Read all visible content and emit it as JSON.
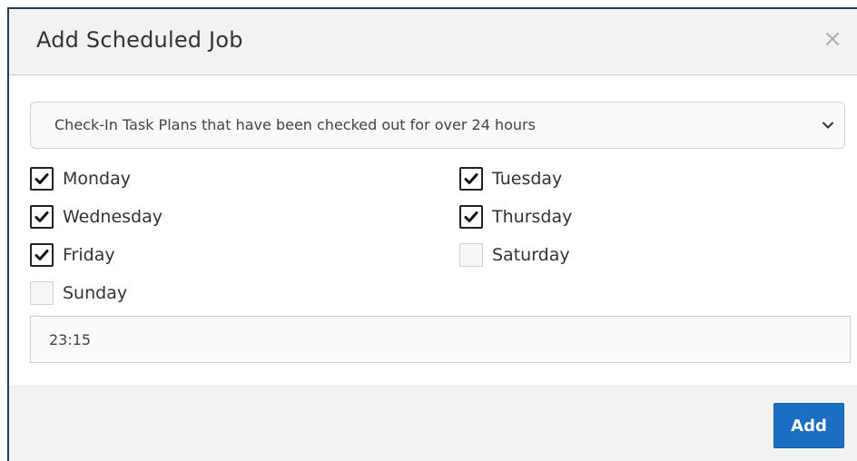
{
  "modal": {
    "title": "Add Scheduled Job",
    "close_label": "×"
  },
  "job_select": {
    "selected": "Check-In Task Plans that have been checked out for over 24 hours",
    "icon": "chevron-down-icon"
  },
  "days": [
    {
      "label": "Monday",
      "checked": true
    },
    {
      "label": "Tuesday",
      "checked": true
    },
    {
      "label": "Wednesday",
      "checked": true
    },
    {
      "label": "Thursday",
      "checked": true
    },
    {
      "label": "Friday",
      "checked": true
    },
    {
      "label": "Saturday",
      "checked": false
    },
    {
      "label": "Sunday",
      "checked": false
    }
  ],
  "time_input": {
    "value": "23:15"
  },
  "footer": {
    "add_label": "Add"
  },
  "colors": {
    "primary_button": "#1a6fc4",
    "header_background": "#f2f2f2",
    "modal_border": "#1f3d63"
  }
}
